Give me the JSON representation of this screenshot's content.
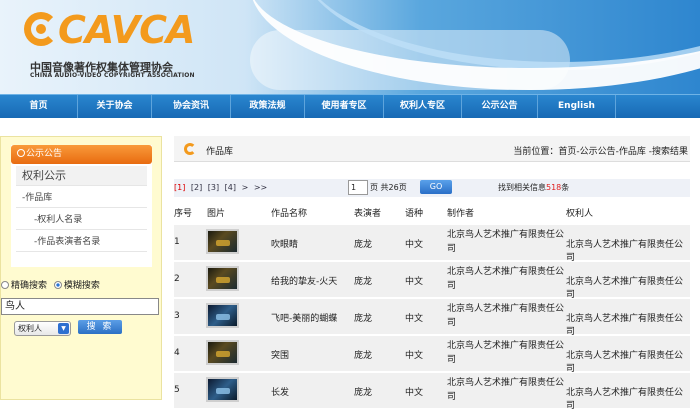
{
  "header": {
    "logo_text": "CAVCA",
    "logo_cn": "中国音像著作权集体管理协会",
    "logo_en": "CHINA AUDIO-VIDEO COPYRIGHT ASSOCIATION"
  },
  "nav": {
    "items": [
      "首页",
      "关于协会",
      "协会资讯",
      "政策法规",
      "使用者专区",
      "权利人专区",
      "公示公告",
      "English"
    ]
  },
  "sidebar": {
    "title": "公示公告",
    "items": [
      "权利公示",
      "-作品库",
      "-权利人名录",
      "-作品表演者名录"
    ]
  },
  "search": {
    "options": [
      "精确搜索",
      "模糊搜索"
    ],
    "selected_option": "模糊搜索",
    "keyword": "鸟人",
    "field": "权利人",
    "button": "搜 索"
  },
  "main": {
    "title": "作品库",
    "breadcrumb": "当前位置：首页-公示公告-作品库 -搜索结果",
    "pager": {
      "pages": [
        "[1]",
        "[2]",
        "[3]",
        "[4]",
        ">",
        ">>"
      ],
      "current_page": "1",
      "total_label": "页 共26页",
      "go_label": "GO",
      "found_prefix": "找到相关信息",
      "found_count": "518",
      "found_suffix": "条"
    },
    "columns": [
      "序号",
      "图片",
      "作品名称",
      "表演者",
      "语种",
      "制作者",
      "权利人"
    ],
    "rows": [
      {
        "no": "1",
        "title": "吹眼睛",
        "performer": "庞龙",
        "language": "中文",
        "producer": "北京鸟人艺术推广有限责任公司",
        "owner": "北京鸟人艺术推广有限责任公司"
      },
      {
        "no": "2",
        "title": "给我的挚友-火天",
        "performer": "庞龙",
        "language": "中文",
        "producer": "北京鸟人艺术推广有限责任公司",
        "owner": "北京鸟人艺术推广有限责任公司"
      },
      {
        "no": "3",
        "title": "飞吧-美丽的蝴蝶",
        "performer": "庞龙",
        "language": "中文",
        "producer": "北京鸟人艺术推广有限责任公司",
        "owner": "北京鸟人艺术推广有限责任公司"
      },
      {
        "no": "4",
        "title": "突围",
        "performer": "庞龙",
        "language": "中文",
        "producer": "北京鸟人艺术推广有限责任公司",
        "owner": "北京鸟人艺术推广有限责任公司"
      },
      {
        "no": "5",
        "title": "长发",
        "performer": "庞龙",
        "language": "中文",
        "producer": "北京鸟人艺术推广有限责任公司",
        "owner": "北京鸟人艺术推广有限责任公司"
      }
    ]
  }
}
